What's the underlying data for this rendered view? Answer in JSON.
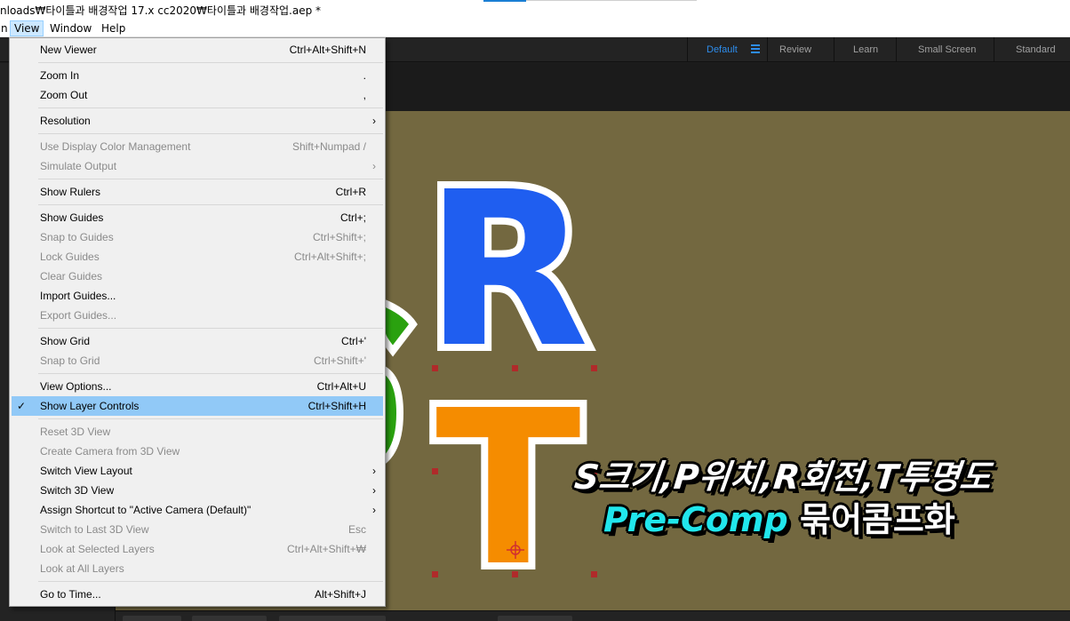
{
  "window": {
    "title": "nloads₩타이틀과 배경작업 17.x cc2020₩타이틀과 배경작업.aep *"
  },
  "menubar": {
    "partial": "n",
    "items": [
      "View",
      "Window",
      "Help"
    ],
    "active": "View"
  },
  "workspaces": {
    "items": [
      "Default",
      "Review",
      "Learn",
      "Small Screen",
      "Standard"
    ],
    "active": "Default",
    "menu_icon": "hamburger-icon"
  },
  "view_menu": {
    "items": [
      {
        "label": "New Viewer",
        "shortcut": "Ctrl+Alt+Shift+N",
        "enabled": true
      },
      {
        "label": "Zoom In",
        "shortcut": ".",
        "enabled": true
      },
      {
        "label": "Zoom Out",
        "shortcut": ",",
        "enabled": true
      },
      {
        "label": "Resolution",
        "submenu": true,
        "enabled": true
      },
      {
        "label": "Use Display Color Management",
        "shortcut": "Shift+Numpad /",
        "enabled": false
      },
      {
        "label": "Simulate Output",
        "submenu": true,
        "enabled": false
      },
      {
        "label": "Show Rulers",
        "shortcut": "Ctrl+R",
        "enabled": true
      },
      {
        "label": "Show Guides",
        "shortcut": "Ctrl+;",
        "enabled": true
      },
      {
        "label": "Snap to Guides",
        "shortcut": "Ctrl+Shift+;",
        "enabled": false
      },
      {
        "label": "Lock Guides",
        "shortcut": "Ctrl+Alt+Shift+;",
        "enabled": false
      },
      {
        "label": "Clear Guides",
        "enabled": false
      },
      {
        "label": "Import Guides...",
        "enabled": true
      },
      {
        "label": "Export Guides...",
        "enabled": false
      },
      {
        "label": "Show Grid",
        "shortcut": "Ctrl+'",
        "enabled": true
      },
      {
        "label": "Snap to Grid",
        "shortcut": "Ctrl+Shift+'",
        "enabled": false
      },
      {
        "label": "View Options...",
        "shortcut": "Ctrl+Alt+U",
        "enabled": true
      },
      {
        "label": "Show Layer Controls",
        "shortcut": "Ctrl+Shift+H",
        "enabled": true,
        "checked": true,
        "highlighted": true
      },
      {
        "label": "Reset 3D View",
        "enabled": false
      },
      {
        "label": "Create Camera from 3D View",
        "enabled": false
      },
      {
        "label": "Switch View Layout",
        "submenu": true,
        "enabled": true
      },
      {
        "label": "Switch 3D View",
        "submenu": true,
        "enabled": true
      },
      {
        "label": "Assign Shortcut to \"Active Camera (Default)\"",
        "submenu": true,
        "enabled": true
      },
      {
        "label": "Switch to Last 3D View",
        "shortcut": "Esc",
        "enabled": false
      },
      {
        "label": "Look at Selected Layers",
        "shortcut": "Ctrl+Alt+Shift+₩",
        "enabled": false
      },
      {
        "label": "Look at All Layers",
        "enabled": false
      },
      {
        "label": "Go to Time...",
        "shortcut": "Alt+Shift+J",
        "enabled": true
      }
    ]
  },
  "composition": {
    "background": "#736840",
    "letters": [
      {
        "char": "R",
        "color": "#1f5ef0"
      },
      {
        "char": "T",
        "color": "#f58c00"
      }
    ],
    "caption": {
      "line1": "S크기,P위치,R회전,T투명도",
      "line2_highlight": "Pre-Comp",
      "line2_rest": " 묶어콤프화"
    }
  }
}
